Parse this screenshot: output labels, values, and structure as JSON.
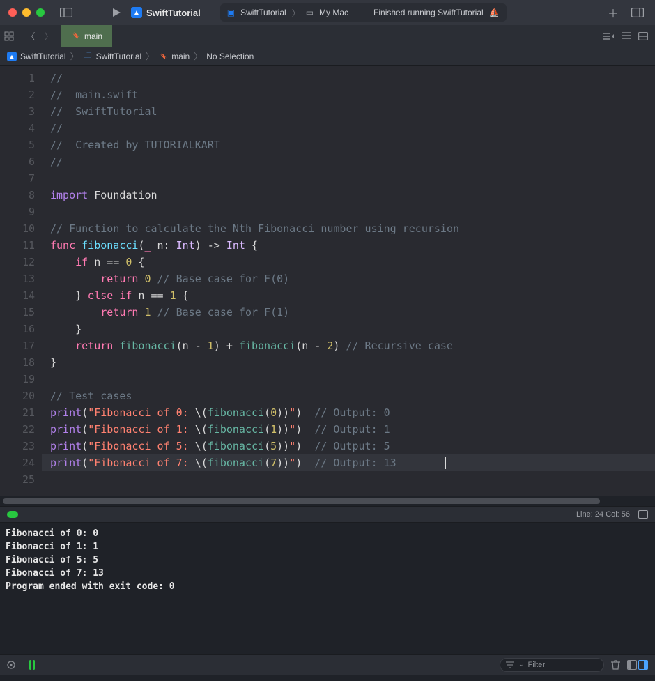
{
  "titlebar": {
    "scheme_name": "SwiftTutorial",
    "status_scheme": "SwiftTutorial",
    "status_dest": "My Mac",
    "status_msg": "Finished running SwiftTutorial"
  },
  "tab": {
    "name": "main"
  },
  "jumpbar": {
    "proj": "SwiftTutorial",
    "folder": "SwiftTutorial",
    "file": "main",
    "selection": "No Selection"
  },
  "gutter": {
    "start": 1,
    "end": 25
  },
  "code": {
    "lines": [
      [
        {
          "c": "cm",
          "t": "//"
        }
      ],
      [
        {
          "c": "cm",
          "t": "//  main.swift"
        }
      ],
      [
        {
          "c": "cm",
          "t": "//  SwiftTutorial"
        }
      ],
      [
        {
          "c": "cm",
          "t": "//"
        }
      ],
      [
        {
          "c": "cm",
          "t": "//  Created by TUTORIALKART"
        }
      ],
      [
        {
          "c": "cm",
          "t": "//"
        }
      ],
      [],
      [
        {
          "c": "kw3",
          "t": "import"
        },
        {
          "c": "id",
          "t": " Foundation"
        }
      ],
      [],
      [
        {
          "c": "cm",
          "t": "// Function to calculate the Nth Fibonacci number using recursion"
        }
      ],
      [
        {
          "c": "kw",
          "t": "func"
        },
        {
          "c": "id",
          "t": " "
        },
        {
          "c": "fnd",
          "t": "fibonacci"
        },
        {
          "c": "op",
          "t": "("
        },
        {
          "c": "kw",
          "t": "_"
        },
        {
          "c": "id",
          "t": " n: "
        },
        {
          "c": "ty",
          "t": "Int"
        },
        {
          "c": "op",
          "t": ") -> "
        },
        {
          "c": "ty",
          "t": "Int"
        },
        {
          "c": "op",
          "t": " {"
        }
      ],
      [
        {
          "c": "id",
          "t": "    "
        },
        {
          "c": "kw",
          "t": "if"
        },
        {
          "c": "id",
          "t": " n "
        },
        {
          "c": "op",
          "t": "=="
        },
        {
          "c": "id",
          "t": " "
        },
        {
          "c": "nm",
          "t": "0"
        },
        {
          "c": "op",
          "t": " {"
        }
      ],
      [
        {
          "c": "id",
          "t": "        "
        },
        {
          "c": "kw",
          "t": "return"
        },
        {
          "c": "id",
          "t": " "
        },
        {
          "c": "nm",
          "t": "0"
        },
        {
          "c": "id",
          "t": " "
        },
        {
          "c": "cm",
          "t": "// Base case for F(0)"
        }
      ],
      [
        {
          "c": "id",
          "t": "    "
        },
        {
          "c": "op",
          "t": "}"
        },
        {
          "c": "id",
          "t": " "
        },
        {
          "c": "kw",
          "t": "else if"
        },
        {
          "c": "id",
          "t": " n "
        },
        {
          "c": "op",
          "t": "=="
        },
        {
          "c": "id",
          "t": " "
        },
        {
          "c": "nm",
          "t": "1"
        },
        {
          "c": "op",
          "t": " {"
        }
      ],
      [
        {
          "c": "id",
          "t": "        "
        },
        {
          "c": "kw",
          "t": "return"
        },
        {
          "c": "id",
          "t": " "
        },
        {
          "c": "nm",
          "t": "1"
        },
        {
          "c": "id",
          "t": " "
        },
        {
          "c": "cm",
          "t": "// Base case for F(1)"
        }
      ],
      [
        {
          "c": "id",
          "t": "    "
        },
        {
          "c": "op",
          "t": "}"
        }
      ],
      [
        {
          "c": "id",
          "t": "    "
        },
        {
          "c": "kw",
          "t": "return"
        },
        {
          "c": "id",
          "t": " "
        },
        {
          "c": "fn",
          "t": "fibonacci"
        },
        {
          "c": "op",
          "t": "(n "
        },
        {
          "c": "op",
          "t": "-"
        },
        {
          "c": "id",
          "t": " "
        },
        {
          "c": "nm",
          "t": "1"
        },
        {
          "c": "op",
          "t": ") + "
        },
        {
          "c": "fn",
          "t": "fibonacci"
        },
        {
          "c": "op",
          "t": "(n "
        },
        {
          "c": "op",
          "t": "-"
        },
        {
          "c": "id",
          "t": " "
        },
        {
          "c": "nm",
          "t": "2"
        },
        {
          "c": "op",
          "t": ")"
        },
        {
          "c": "id",
          "t": " "
        },
        {
          "c": "cm",
          "t": "// Recursive case"
        }
      ],
      [
        {
          "c": "op",
          "t": "}"
        }
      ],
      [],
      [
        {
          "c": "cm",
          "t": "// Test cases"
        }
      ],
      [
        {
          "c": "pr",
          "t": "print"
        },
        {
          "c": "op",
          "t": "("
        },
        {
          "c": "st",
          "t": "\"Fibonacci of 0: "
        },
        {
          "c": "op",
          "t": "\\("
        },
        {
          "c": "fn",
          "t": "fibonacci"
        },
        {
          "c": "op",
          "t": "("
        },
        {
          "c": "nm",
          "t": "0"
        },
        {
          "c": "op",
          "t": "))"
        },
        {
          "c": "st",
          "t": "\""
        },
        {
          "c": "op",
          "t": ")"
        },
        {
          "c": "id",
          "t": "  "
        },
        {
          "c": "cm",
          "t": "// Output: 0"
        }
      ],
      [
        {
          "c": "pr",
          "t": "print"
        },
        {
          "c": "op",
          "t": "("
        },
        {
          "c": "st",
          "t": "\"Fibonacci of 1: "
        },
        {
          "c": "op",
          "t": "\\("
        },
        {
          "c": "fn",
          "t": "fibonacci"
        },
        {
          "c": "op",
          "t": "("
        },
        {
          "c": "nm",
          "t": "1"
        },
        {
          "c": "op",
          "t": "))"
        },
        {
          "c": "st",
          "t": "\""
        },
        {
          "c": "op",
          "t": ")"
        },
        {
          "c": "id",
          "t": "  "
        },
        {
          "c": "cm",
          "t": "// Output: 1"
        }
      ],
      [
        {
          "c": "pr",
          "t": "print"
        },
        {
          "c": "op",
          "t": "("
        },
        {
          "c": "st",
          "t": "\"Fibonacci of 5: "
        },
        {
          "c": "op",
          "t": "\\("
        },
        {
          "c": "fn",
          "t": "fibonacci"
        },
        {
          "c": "op",
          "t": "("
        },
        {
          "c": "nm",
          "t": "5"
        },
        {
          "c": "op",
          "t": "))"
        },
        {
          "c": "st",
          "t": "\""
        },
        {
          "c": "op",
          "t": ")"
        },
        {
          "c": "id",
          "t": "  "
        },
        {
          "c": "cm",
          "t": "// Output: 5"
        }
      ],
      [
        {
          "c": "pr",
          "t": "print"
        },
        {
          "c": "op",
          "t": "("
        },
        {
          "c": "st",
          "t": "\"Fibonacci of 7: "
        },
        {
          "c": "op",
          "t": "\\("
        },
        {
          "c": "fn",
          "t": "fibonacci"
        },
        {
          "c": "op",
          "t": "("
        },
        {
          "c": "nm",
          "t": "7"
        },
        {
          "c": "op",
          "t": "))"
        },
        {
          "c": "st",
          "t": "\""
        },
        {
          "c": "op",
          "t": ")"
        },
        {
          "c": "id",
          "t": "  "
        },
        {
          "c": "cm",
          "t": "// Output: 13"
        }
      ],
      []
    ],
    "cursor_line_index": 23
  },
  "midbar": {
    "pos": "Line: 24  Col: 56"
  },
  "console_lines": [
    "Fibonacci of 0: 0",
    "Fibonacci of 1: 1",
    "Fibonacci of 5: 5",
    "Fibonacci of 7: 13",
    "Program ended with exit code: 0"
  ],
  "bottombar": {
    "filter_placeholder": "Filter"
  }
}
